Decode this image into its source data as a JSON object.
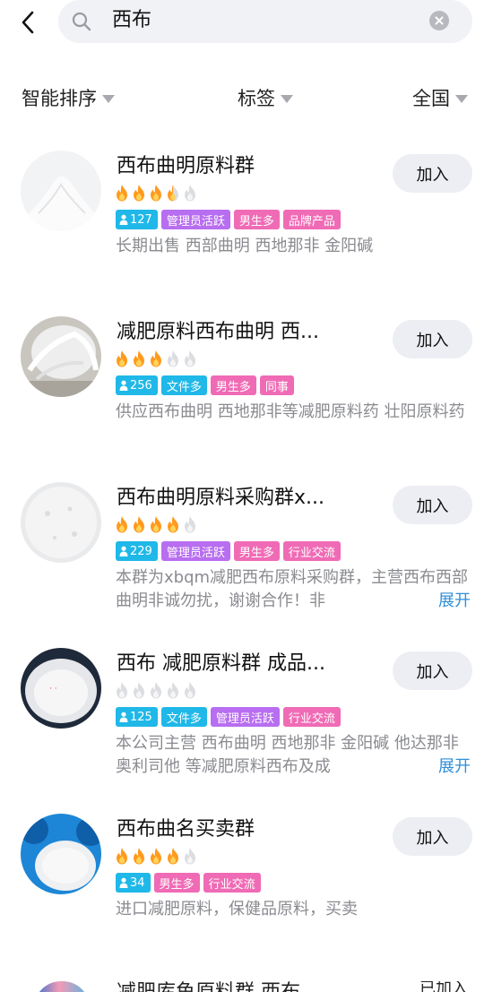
{
  "search": {
    "query": "西布"
  },
  "filters": {
    "sort": "智能排序",
    "tag": "标签",
    "region": "全国"
  },
  "results": [
    {
      "name": "西布曲明原料群",
      "join_label": "加入",
      "heat": 3.5,
      "member_count": "127",
      "tags": [
        "管理员活跃",
        "男生多",
        "品牌产品"
      ],
      "description": "长期出售 西部曲明 西地那非 金阳碱",
      "expand_label": ""
    },
    {
      "name": "减肥原料西布曲明 西...",
      "join_label": "加入",
      "heat": 3,
      "member_count": "256",
      "tags": [
        "文件多",
        "男生多",
        "同事"
      ],
      "description": "供应西布曲明 西地那非等减肥原料药 壮阳原料药",
      "expand_label": ""
    },
    {
      "name": "西布曲明原料采购群x...",
      "join_label": "加入",
      "heat": 4,
      "member_count": "229",
      "tags": [
        "管理员活跃",
        "男生多",
        "行业交流"
      ],
      "description": "本群为xbqm减肥西布原料采购群，主营西布西部曲明非诚勿扰，谢谢合作！非",
      "expand_label": "展开"
    },
    {
      "name": "西布 减肥原料群 成品...",
      "join_label": "加入",
      "heat": 0,
      "member_count": "125",
      "tags": [
        "文件多",
        "管理员活跃",
        "行业交流"
      ],
      "description": "本公司主营 西布曲明 西地那非 金阳碱 他达那非 奥利司他 等减肥原料西布及成",
      "expand_label": "展开"
    },
    {
      "name": "西布曲名买卖群",
      "join_label": "加入",
      "heat": 4,
      "member_count": "34",
      "tags": [
        "男生多",
        "行业交流"
      ],
      "description": "进口减肥原料，保健品原料，买卖",
      "expand_label": ""
    }
  ],
  "partial_item": {
    "name": "减肥库鱼原料群 西布...",
    "join_label": "已加入"
  },
  "colors": {
    "tag_count": "#1fb8e8",
    "tag_purple": "#b86ef0",
    "tag_pink": "#f06bb5",
    "expand_link": "#2f8fd8",
    "fire_on": "#ff9a1f",
    "fire_off": "#dcdde1"
  },
  "icons": {
    "back": "chevron-left-icon",
    "search": "search-icon",
    "clear": "clear-icon",
    "fire": "fire-icon",
    "member": "person-icon"
  }
}
